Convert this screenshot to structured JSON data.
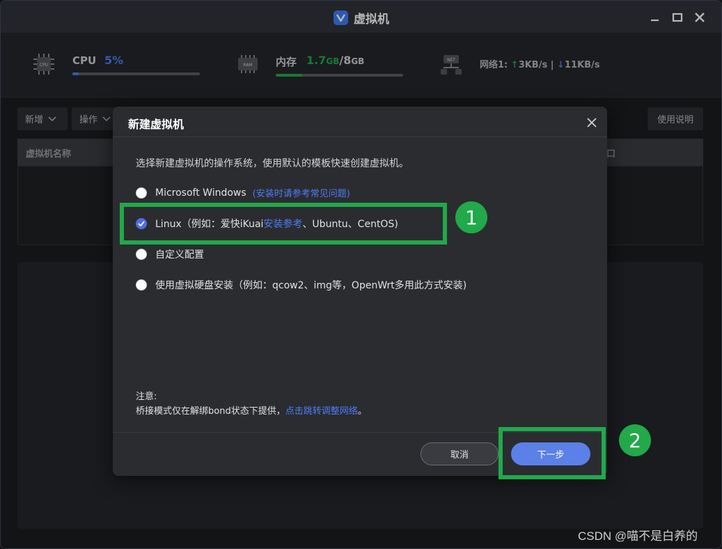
{
  "window": {
    "title": "虚拟机",
    "logo_letter": "V"
  },
  "stats": {
    "cpu": {
      "label": "CPU",
      "value": "5%",
      "percent": 5,
      "color": "#4c7df5"
    },
    "ram": {
      "label": "内存",
      "used": "1.7",
      "used_unit": "GB",
      "total": "8",
      "total_unit": "GB",
      "separator": "/",
      "percent": 21,
      "color": "#21a94a"
    },
    "network": {
      "label": "网络1:",
      "up": "3KB/s",
      "sep": "|",
      "down": "11KB/s"
    },
    "icon_texts": {
      "cpu": "CPU",
      "ram": "RAM",
      "net": "NET"
    }
  },
  "toolbar": {
    "add_label": "新增",
    "ops_label": "操作",
    "help_label": "使用说明"
  },
  "table": {
    "col_name": "虚拟机名称",
    "col_right": "口"
  },
  "dialog": {
    "title": "新建虚拟机",
    "description": "选择新建虚拟机的操作系统，使用默认的模板快速创建虚拟机。",
    "options": [
      {
        "label": "Microsoft Windows",
        "link": "(安装时请参考常见问题)",
        "checked": false
      },
      {
        "label_before": "Linux（例如：爱快iKuai",
        "link": "安装参考",
        "label_after": "、Ubuntu、CentOS)",
        "checked": true
      },
      {
        "label": "自定义配置",
        "checked": false
      },
      {
        "label": "使用虚拟硬盘安装（例如：qcow2、img等，OpenWrt多用此方式安装)",
        "checked": false
      }
    ],
    "note_label": "注意:",
    "note_text": "桥接模式仅在解绑bond状态下提供，",
    "note_link": "点击跳转调整网络",
    "note_end": "。",
    "cancel_label": "取消",
    "next_label": "下一步"
  },
  "annotations": {
    "step1": "1",
    "step2": "2",
    "highlight_color": "#21a94a"
  },
  "watermark": "CSDN @喵不是白养的"
}
